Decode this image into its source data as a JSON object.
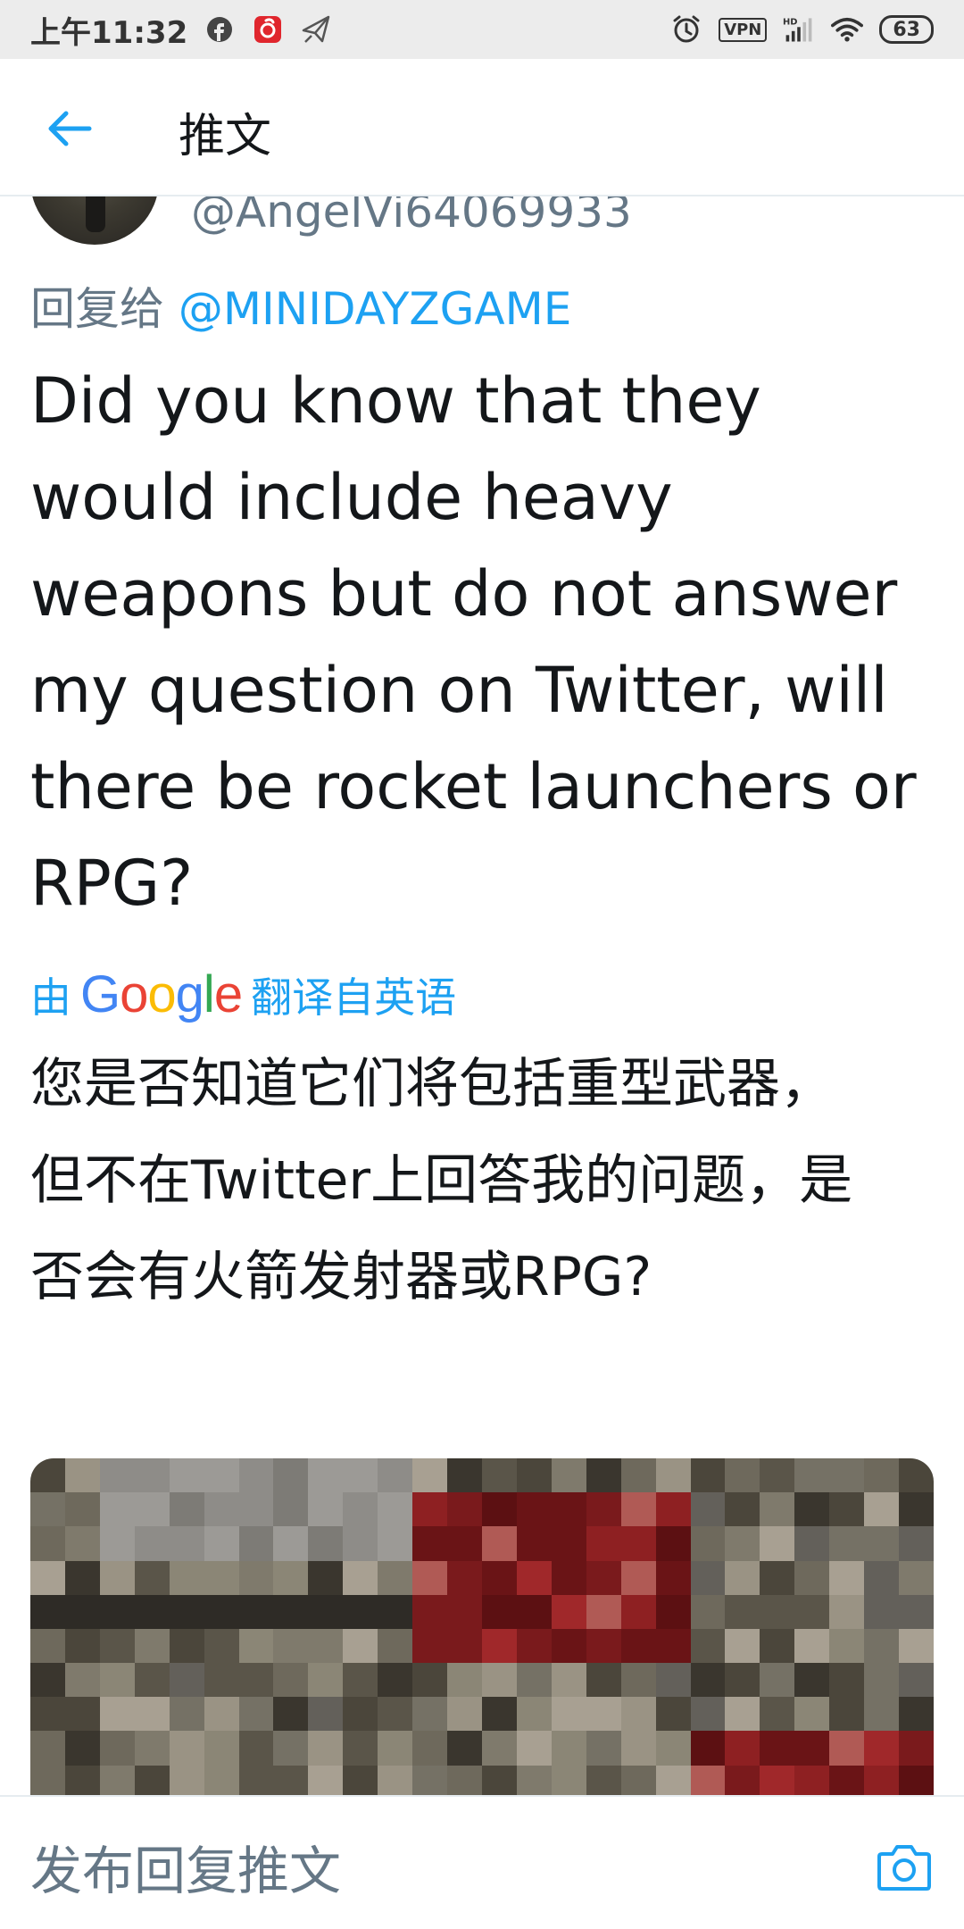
{
  "status_bar": {
    "time": "上午11:32",
    "icons": [
      "facebook-icon",
      "netease-music-icon",
      "send-icon"
    ],
    "right_icons": [
      "alarm-icon",
      "vpn-icon",
      "hd-signal-icon",
      "wifi-icon",
      "battery-icon"
    ],
    "vpn_label": "VPN",
    "battery": "63"
  },
  "header": {
    "back_icon": "arrow-left-icon",
    "title": "推文"
  },
  "tweet": {
    "handle": "@AngelVi64069933",
    "replying_prefix": "回复给",
    "replying_to": "@MINIDAYZGAME",
    "text": "Did you know that they would include heavy weapons but do not answer my question on Twitter, will there be rocket launchers or RPG?",
    "translated_prefix": "由",
    "translated_brand": "Google",
    "translated_suffix": "翻译自英语",
    "translation": "您是否知道它们将包括重型武器，但不在Twitter上回答我的问题，是否会有火箭发射器或RPG?"
  },
  "reply_bar": {
    "placeholder": "发布回复推文",
    "camera_icon": "camera-icon"
  },
  "colors": {
    "accent": "#1da1f2",
    "secondary_text": "#657786",
    "status_bar": "#ececec"
  }
}
